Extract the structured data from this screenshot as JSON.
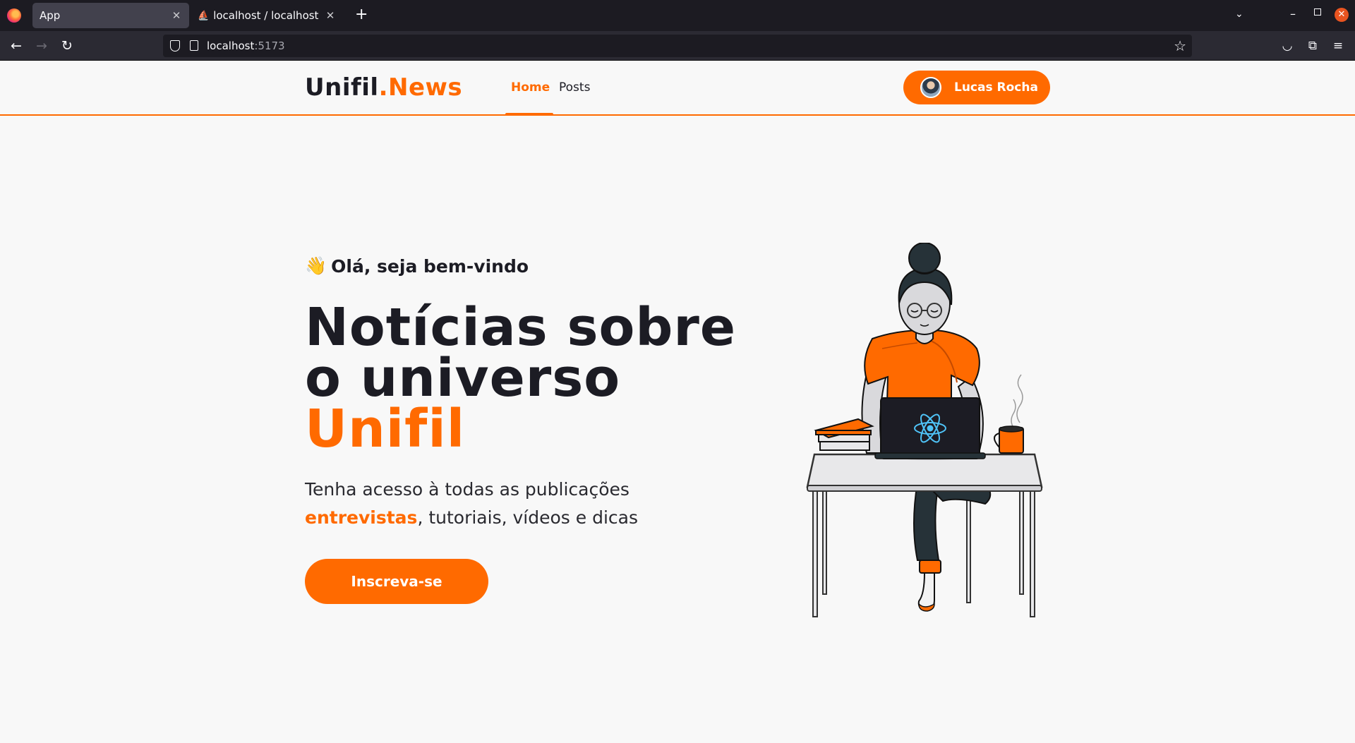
{
  "browser": {
    "tabs": [
      {
        "title": "App",
        "active": true
      },
      {
        "title": "localhost / localhost / cru",
        "active": false
      }
    ],
    "url_host": "localhost",
    "url_port": ":5173"
  },
  "site": {
    "brand_main": "Unifil",
    "brand_accent": ".News",
    "nav": [
      {
        "label": "Home",
        "active": true
      },
      {
        "label": "Posts",
        "active": false
      }
    ],
    "user_name": "Lucas Rocha"
  },
  "hero": {
    "wave_emoji": "👋",
    "greeting": "Olá, seja bem-vindo",
    "headline_line1": "Notícias sobre",
    "headline_line2": "o universo",
    "headline_accent": "Unifil",
    "sub_line1": "Tenha acesso à todas as publicações",
    "sub_emphasis": "entrevistas",
    "sub_rest": ", tutoriais, vídeos e dicas",
    "cta_label": "Inscreva-se"
  },
  "colors": {
    "accent": "#ff6a00",
    "text_dark": "#1c1c24",
    "background": "#f8f8f8"
  },
  "icons": [
    "firefox-icon",
    "close-icon",
    "plus-icon",
    "chevron-down-icon",
    "back-icon",
    "forward-icon",
    "reload-icon",
    "shield-icon",
    "page-icon",
    "bookmark-star-icon",
    "pocket-icon",
    "extensions-icon",
    "menu-icon",
    "react-logo-icon"
  ]
}
